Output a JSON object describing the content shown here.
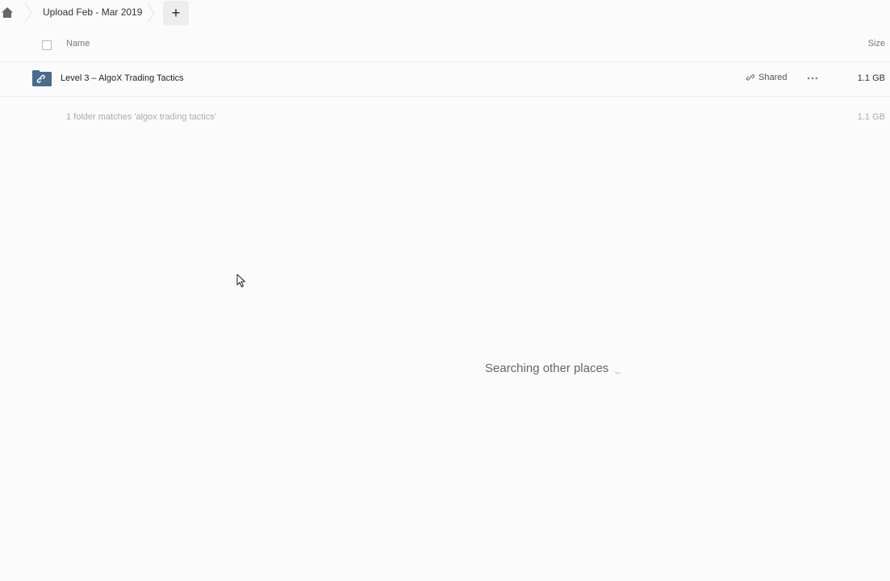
{
  "breadcrumb": {
    "home_icon": "home-icon",
    "current_folder": "Upload Feb - Mar 2019",
    "add_label": "+"
  },
  "table": {
    "columns": {
      "name": "Name",
      "size": "Size"
    },
    "rows": [
      {
        "icon": "shared-folder-link-icon",
        "name": "Level 3 – AlgoX Trading Tactics",
        "shared_label": "Shared",
        "size": "1.1 GB"
      }
    ],
    "summary": {
      "text": "1 folder matches 'algox trading tactics'",
      "size": "1.1 GB"
    }
  },
  "status": {
    "searching_text": "Searching other places"
  },
  "colors": {
    "background": "#fbfbfb",
    "folder": "#4a6a8e",
    "add_button_bg": "#ededed"
  }
}
